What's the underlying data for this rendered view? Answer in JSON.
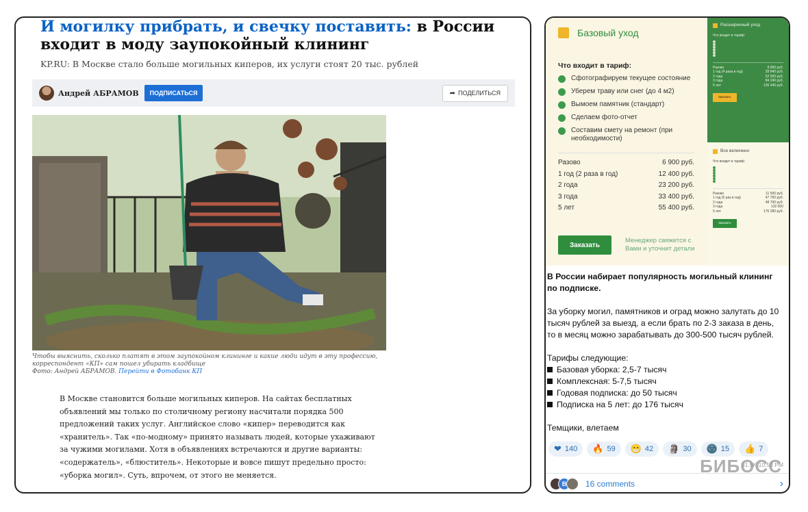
{
  "article": {
    "headline_blue": "И могилку прибрать, и свечку поставить:",
    "headline_black": " в России входит в моду заупокойный клининг",
    "lead": "KP.RU: В Москве стало больше могильных киперов, их услуги стоят 20 тыс. рублей",
    "author": "Андрей АБРАМОВ",
    "subscribe": "ПОДПИСАТЬСЯ",
    "share": "ПОДЕЛИТЬСЯ",
    "caption_line1": "Чтобы выяснить, сколько платят в этом заупокойном клининге и какие люди идут в эту профессию,",
    "caption_line2": "корреспондент «КП» сам пошел убирать кладбище",
    "caption_photo": "Фото: Андрей АБРАМОВ. ",
    "caption_link": "Перейти в Фотобанк КП",
    "body": [
      "В Москве становится больше могильных киперов. На сайтах бесплатных",
      "объявлений мы только по столичному региону насчитали порядка 500",
      "предложений таких услуг. Английское слово «кипер» переводится как",
      "«хранитель». Так «по-модному» принято называть людей, которые ухаживают",
      "за чужими могилами. Хотя в объявлениях встречаются и другие варианты:",
      "«содержатель», «блюститель». Некоторые и вовсе пишут предельно просто:",
      "«уборка могил». Суть, впрочем, от этого не меняется."
    ]
  },
  "promo": {
    "base": {
      "title": "Базовый уход",
      "included_label": "Что входит в тариф:",
      "features": [
        "Сфотографируем текущее состояние",
        "Уберем траву или снег (до 4 м2)",
        "Вымоем памятник (стандарт)",
        "Сделаем фото-отчет",
        "Составим смету на ремонт (при необходимости)"
      ],
      "prices": [
        {
          "label": "Разово",
          "price": "6 900 руб."
        },
        {
          "label": "1 год (2 раза в год)",
          "price": "12 400 руб."
        },
        {
          "label": "2 года",
          "price": "23 200 руб."
        },
        {
          "label": "3 года",
          "price": "33 400 руб."
        },
        {
          "label": "5 лет",
          "price": "55 400 руб."
        }
      ],
      "order": "Заказать",
      "manager_note": "Менеджер свяжется с Вами и уточнит детали"
    },
    "extended": {
      "title": "Расширенный уход",
      "included_label": "Что входит в тариф:",
      "features": [
        "",
        "",
        "",
        "",
        "",
        ""
      ],
      "prices": [
        {
          "label": "Разово",
          "price": "8 900 руб."
        },
        {
          "label": "1 год (4 раза в год)",
          "price": "28 840 руб."
        },
        {
          "label": "2 года",
          "price": "52 000 руб."
        },
        {
          "label": "3 года",
          "price": "84 240 руб."
        },
        {
          "label": "5 лет",
          "price": "136 440 руб."
        }
      ],
      "order": "Заказать"
    },
    "all": {
      "title": "Все включено",
      "included_label": "Что входит в тариф:",
      "features": [
        "",
        "",
        "",
        "",
        "",
        ""
      ],
      "prices": [
        {
          "label": "Разово",
          "price": "11 500 руб."
        },
        {
          "label": "1 год (5 раз в год)",
          "price": "47 700 руб."
        },
        {
          "label": "2 года",
          "price": "48 700 руб."
        },
        {
          "label": "3 года",
          "price": "132 000"
        },
        {
          "label": "5 лет",
          "price": "176 280 руб."
        }
      ],
      "order": "Заказать"
    }
  },
  "post": {
    "headline": "В России набирает популярность могильный клининг по подписке.",
    "para1": "За уборку могил, памятников и оград можно залутать до 10 тысяч рублей за выезд, а если брать по 2-3 заказа в день, то в месяц можно зарабатывать до 300-500 тысяч рублей.",
    "tariffs_label": "Тарифы следующие:",
    "tariffs": [
      "Базовая уборка: 2,5-7 тысяч",
      "Комплексная: 5-7,5 тысяч",
      "Годовая подписка: до 50 тысяч",
      "Подписка на 5 лет: до 176 тысяч"
    ],
    "closing": "Темщики, влетаем",
    "reactions": [
      {
        "emoji": "❤",
        "count": "140",
        "icon": "heart-icon"
      },
      {
        "emoji": "🔥",
        "count": "59",
        "icon": "fire-icon"
      },
      {
        "emoji": "😁",
        "count": "42",
        "icon": "grin-icon"
      },
      {
        "emoji": "🗿",
        "count": "30",
        "icon": "moai-icon"
      },
      {
        "emoji": "🌚",
        "count": "15",
        "icon": "dark-moon-icon"
      },
      {
        "emoji": "👍",
        "count": "7",
        "icon": "thumbs-up-icon"
      }
    ],
    "meta": "51.9K  10:53 PM",
    "watermark": "БИБОСС",
    "comments": "16 comments",
    "avatar_letter": "B"
  },
  "colors": {
    "accent_blue": "#0b62c4",
    "promo_green": "#2f8d3e",
    "promo_yellow": "#f0b52a",
    "link_blue": "#2a7bd1"
  }
}
